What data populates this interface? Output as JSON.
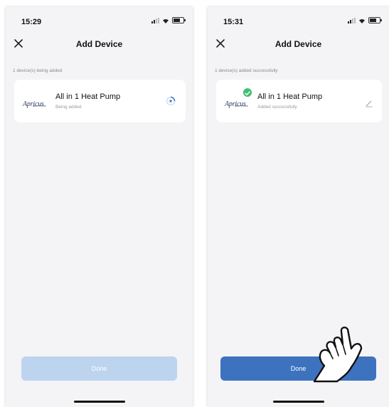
{
  "left_screen": {
    "time": "15:29",
    "title": "Add Device",
    "status_text": "1 device(s) being added",
    "device": {
      "logo_text": "Apricus",
      "logo_subtext": "HEAT PUMP",
      "name": "All in 1 Heat Pump",
      "status": "Being added"
    },
    "done_label": "Done",
    "done_enabled": false
  },
  "right_screen": {
    "time": "15:31",
    "title": "Add Device",
    "status_text": "1 device(s) added successfully",
    "device": {
      "logo_text": "Apricus",
      "logo_subtext": "HEAT PUMP",
      "name": "All in 1 Heat Pump",
      "status": "Added successfully"
    },
    "done_label": "Done",
    "done_enabled": true
  },
  "icons": {
    "close": "close-icon",
    "spinner": "loading-spinner-icon",
    "edit": "pencil-edit-icon",
    "success": "check-circle-icon",
    "pointer": "pointing-hand-icon"
  },
  "colors": {
    "done_disabled": "#bcd4ee",
    "done_enabled": "#3d73be",
    "success_green": "#3fbf72",
    "spinner_blue": "#3d73be"
  }
}
